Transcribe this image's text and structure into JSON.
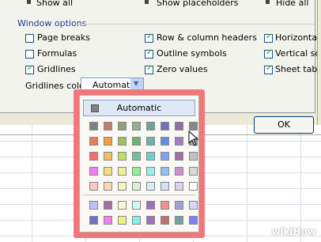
{
  "top_row": [
    "Show all",
    "Show placeholders",
    "Hide all"
  ],
  "window_options": {
    "title": "Window options",
    "checkboxes": [
      {
        "label": "Page breaks",
        "checked": false
      },
      {
        "label": "Row & column headers",
        "checked": true
      },
      {
        "label": "Horizontal scr",
        "checked": true
      },
      {
        "label": "Formulas",
        "checked": false
      },
      {
        "label": "Outline symbols",
        "checked": true
      },
      {
        "label": "Vertical scr",
        "checked": true
      },
      {
        "label": "Gridlines",
        "checked": true
      },
      {
        "label": "Zero values",
        "checked": true
      },
      {
        "label": "Sheet tabs",
        "checked": true
      }
    ],
    "gridlines_color_label": "Gridlines color:",
    "gridlines_color_value": "Automatic"
  },
  "ok_label": "OK",
  "palette": {
    "automatic_label": "Automatic",
    "rows": [
      [
        "#808080",
        "#c08070",
        "#90a070",
        "#90b090",
        "#70a0a0",
        "#7070c0",
        "#9070a0",
        "#888888"
      ],
      [
        "#e08060",
        "#f0a040",
        "#a0c060",
        "#70b070",
        "#70b0b0",
        "#6090e0",
        "#a080c0",
        "#a0a0a0"
      ],
      [
        "#f07070",
        "#f0c060",
        "#c0e060",
        "#70c0a0",
        "#70d0d0",
        "#80a0f0",
        "#a070a0",
        "#c0c0c0"
      ],
      [
        "#f080f0",
        "#f0e080",
        "#f0f090",
        "#90f090",
        "#90f0f0",
        "#90c0f0",
        "#d090d0",
        "#d8d8d8"
      ],
      [
        "#f8c8c8",
        "#f8d8b0",
        "#f8f0c0",
        "#d8f0d0",
        "#d0f0f0",
        "#d0e0f8",
        "#e0d0f0",
        "#ffffff"
      ],
      [
        "#c0c0f8",
        "#a070a0",
        "#f8f8d0",
        "#d0f8f8",
        "#a070c0",
        "#f09090",
        "#a0a0d0",
        "#d8d8f8"
      ],
      [
        "#7070c0",
        "#f080f0",
        "#f0f080",
        "#80f0f0",
        "#a070c0",
        "#c07070",
        "#70a0a0",
        "#8080f0"
      ]
    ]
  },
  "watermark": "wikiHow"
}
